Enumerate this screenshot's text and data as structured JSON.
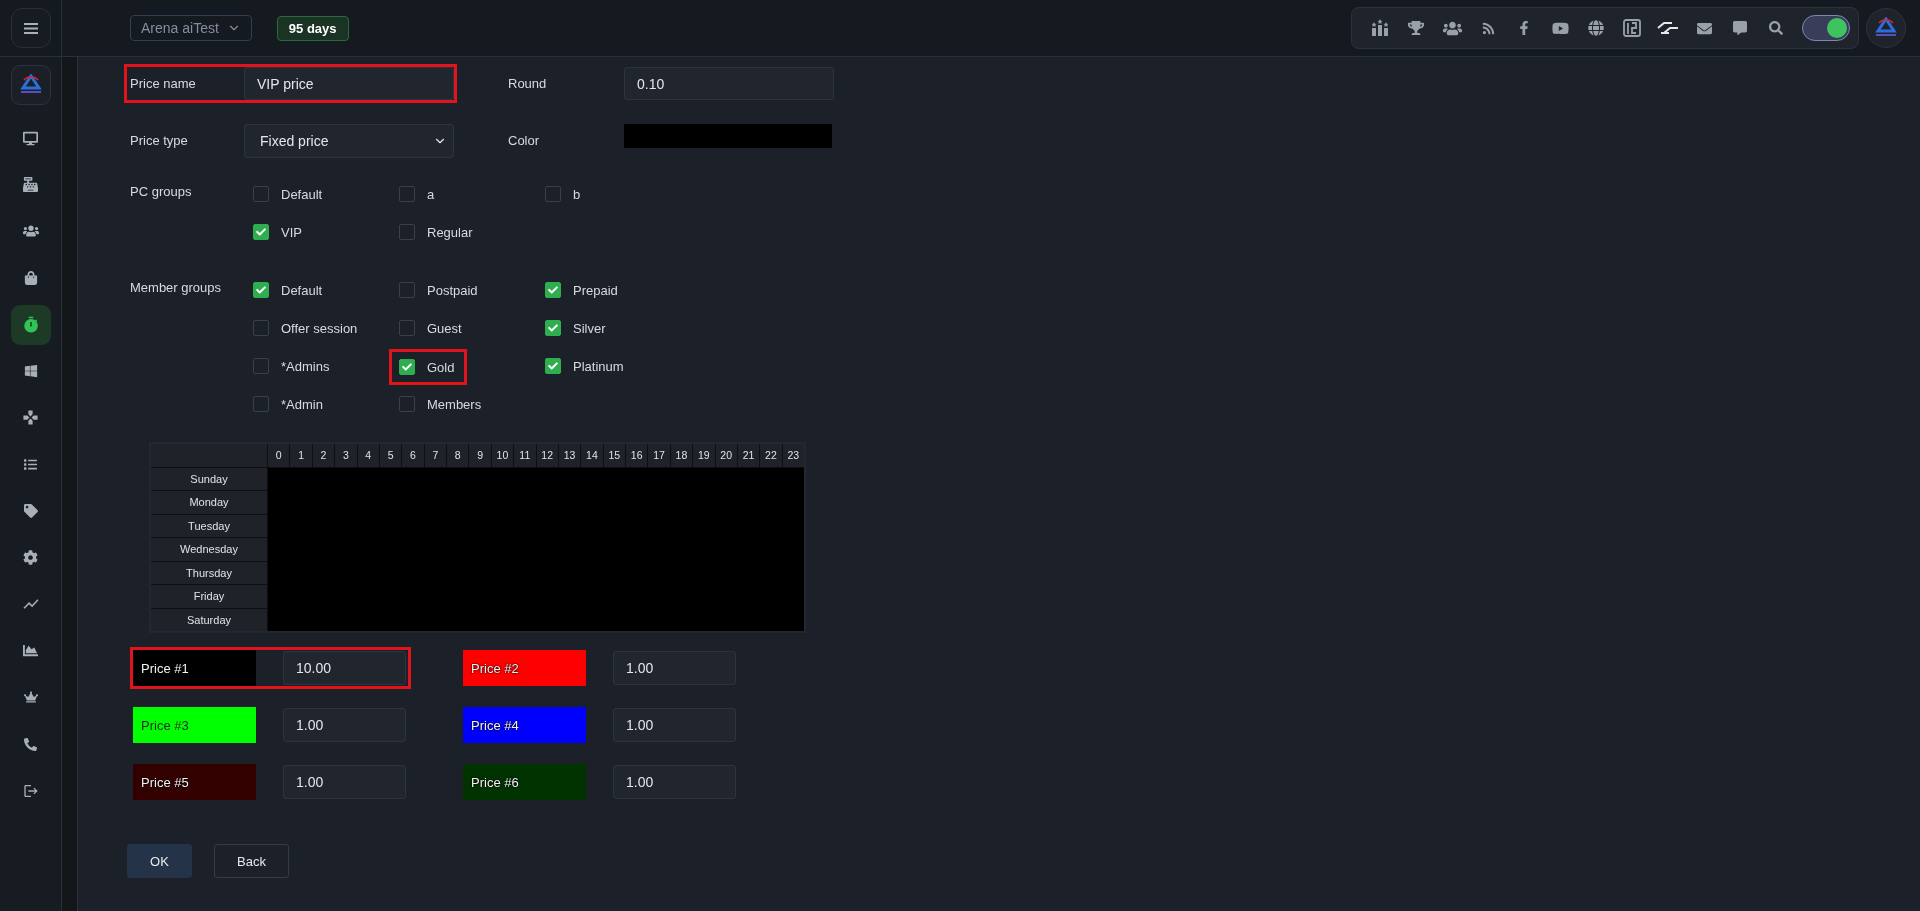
{
  "topbar": {
    "site_selector": "Arena aiTest",
    "license_badge": "95 days",
    "theme_toggle": {
      "on": true
    }
  },
  "toolbar": [
    {
      "kind": "podium"
    },
    {
      "kind": "trophy"
    },
    {
      "kind": "users"
    },
    {
      "kind": "rss"
    },
    {
      "kind": "facebook"
    },
    {
      "kind": "youtube"
    },
    {
      "kind": "globe"
    },
    {
      "kind": "square-logo"
    },
    {
      "kind": "chevrons"
    },
    {
      "kind": "mail"
    },
    {
      "kind": "chat"
    },
    {
      "kind": "search"
    }
  ],
  "sidebar": {
    "items": [
      {
        "kind": "desktop",
        "selected": false
      },
      {
        "kind": "register",
        "selected": false
      },
      {
        "kind": "users",
        "selected": false
      },
      {
        "kind": "bag",
        "selected": false
      },
      {
        "kind": "timer",
        "selected": true
      },
      {
        "kind": "windows",
        "selected": false
      },
      {
        "kind": "games",
        "selected": false
      },
      {
        "kind": "list",
        "selected": false
      },
      {
        "kind": "tag",
        "selected": false
      },
      {
        "kind": "gear",
        "selected": false
      },
      {
        "kind": "line-chart",
        "selected": false
      },
      {
        "kind": "area-chart",
        "selected": false
      },
      {
        "kind": "crown",
        "selected": false
      },
      {
        "kind": "phone",
        "selected": false
      },
      {
        "kind": "logout",
        "selected": false
      }
    ]
  },
  "form": {
    "price_name": {
      "label": "Price name",
      "value": "VIP price",
      "highlighted": true
    },
    "round": {
      "label": "Round",
      "value": "0.10"
    },
    "price_type": {
      "label": "Price type",
      "value": "Fixed price"
    },
    "color": {
      "label": "Color",
      "color": "#000000"
    },
    "pc_groups": {
      "label": "PC groups",
      "items": [
        {
          "label": "Default",
          "checked": false,
          "highlighted": false
        },
        {
          "label": "a",
          "checked": false,
          "highlighted": false
        },
        {
          "label": "b",
          "checked": false,
          "highlighted": false
        },
        {
          "label": "VIP",
          "checked": true,
          "highlighted": false
        },
        {
          "label": "Regular",
          "checked": false,
          "highlighted": false
        }
      ]
    },
    "member_groups": {
      "label": "Member groups",
      "items": [
        {
          "label": "Default",
          "checked": true,
          "highlighted": false
        },
        {
          "label": "Postpaid",
          "checked": false,
          "highlighted": false
        },
        {
          "label": "Prepaid",
          "checked": true,
          "highlighted": false
        },
        {
          "label": "Offer session",
          "checked": false,
          "highlighted": false
        },
        {
          "label": "Guest",
          "checked": false,
          "highlighted": false
        },
        {
          "label": "Silver",
          "checked": true,
          "highlighted": false
        },
        {
          "label": "*Admins",
          "checked": false,
          "highlighted": false
        },
        {
          "label": "Gold",
          "checked": true,
          "highlighted": true
        },
        {
          "label": "Platinum",
          "checked": true,
          "highlighted": false
        },
        {
          "label": "*Admin",
          "checked": false,
          "highlighted": false
        },
        {
          "label": "Members",
          "checked": false,
          "highlighted": false
        }
      ]
    }
  },
  "schedule": {
    "hours": [
      "0",
      "1",
      "2",
      "3",
      "4",
      "5",
      "6",
      "7",
      "8",
      "9",
      "10",
      "11",
      "12",
      "13",
      "14",
      "15",
      "16",
      "17",
      "18",
      "19",
      "20",
      "21",
      "22",
      "23"
    ],
    "days": [
      "Sunday",
      "Monday",
      "Tuesday",
      "Wednesday",
      "Thursday",
      "Friday",
      "Saturday"
    ]
  },
  "prices": [
    {
      "label": "Price #1",
      "value": "10.00",
      "color": "#000000",
      "highlighted": true
    },
    {
      "label": "Price #2",
      "value": "1.00",
      "color": "#ff0000",
      "highlighted": false
    },
    {
      "label": "Price #3",
      "value": "1.00",
      "color": "#00ff00",
      "highlighted": false
    },
    {
      "label": "Price #4",
      "value": "1.00",
      "color": "#0000ff",
      "highlighted": false
    },
    {
      "label": "Price #5",
      "value": "1.00",
      "color": "#330000",
      "highlighted": false
    },
    {
      "label": "Price #6",
      "value": "1.00",
      "color": "#003300",
      "highlighted": false
    }
  ],
  "buttons": [
    {
      "kind": "primary",
      "label": "OK"
    },
    {
      "kind": "secondary",
      "label": "Back"
    }
  ]
}
